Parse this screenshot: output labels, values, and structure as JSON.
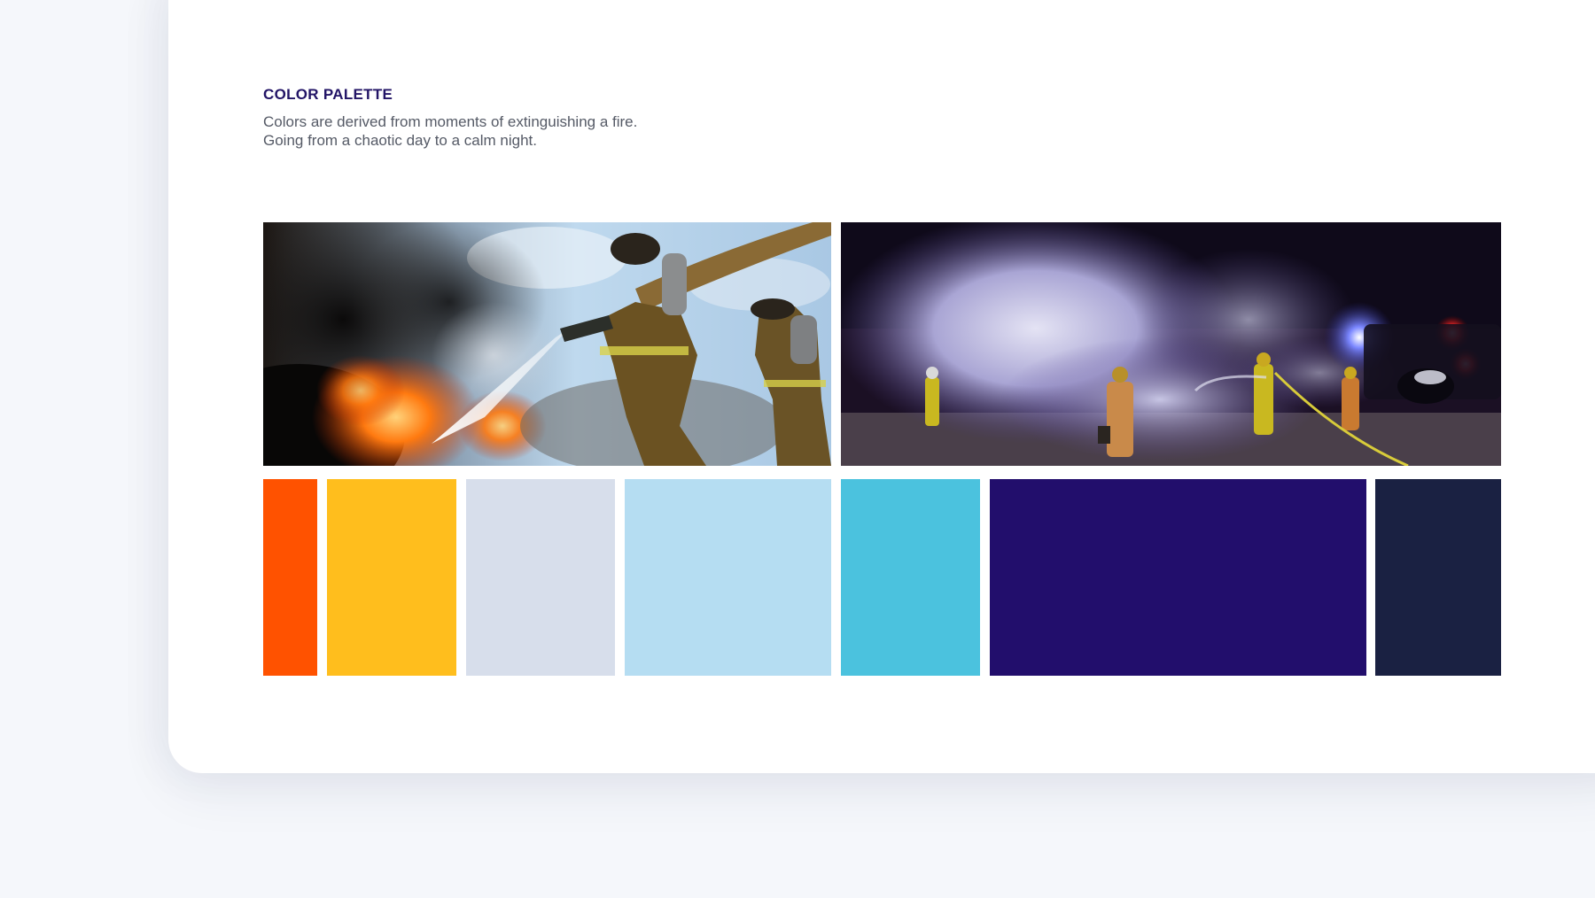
{
  "section": {
    "title": "COLOR PALETTE",
    "description_line1": "Colors are derived from moments of extinguishing a fire.",
    "description_line2": "Going from a chaotic day to a calm night."
  },
  "photos": [
    {
      "name": "day-fire-photo",
      "subject": "firefighters spraying water on burning fire during the day"
    },
    {
      "name": "night-smoke-photo",
      "subject": "firefighters extinguishing smoke at night"
    }
  ],
  "palette": [
    {
      "name": "orange",
      "hex": "#FF5200"
    },
    {
      "name": "yellow",
      "hex": "#FFBE1D"
    },
    {
      "name": "light-gray-blue",
      "hex": "#D7DEEB"
    },
    {
      "name": "light-sky-blue",
      "hex": "#B5DDF2"
    },
    {
      "name": "cyan",
      "hex": "#4BC2DE"
    },
    {
      "name": "deep-indigo",
      "hex": "#220E6C"
    },
    {
      "name": "dark-navy",
      "hex": "#1A2142"
    }
  ],
  "colors": {
    "title": "#221466",
    "text": "#555A66",
    "background": "#F5F7FB",
    "card": "#FFFFFF"
  }
}
